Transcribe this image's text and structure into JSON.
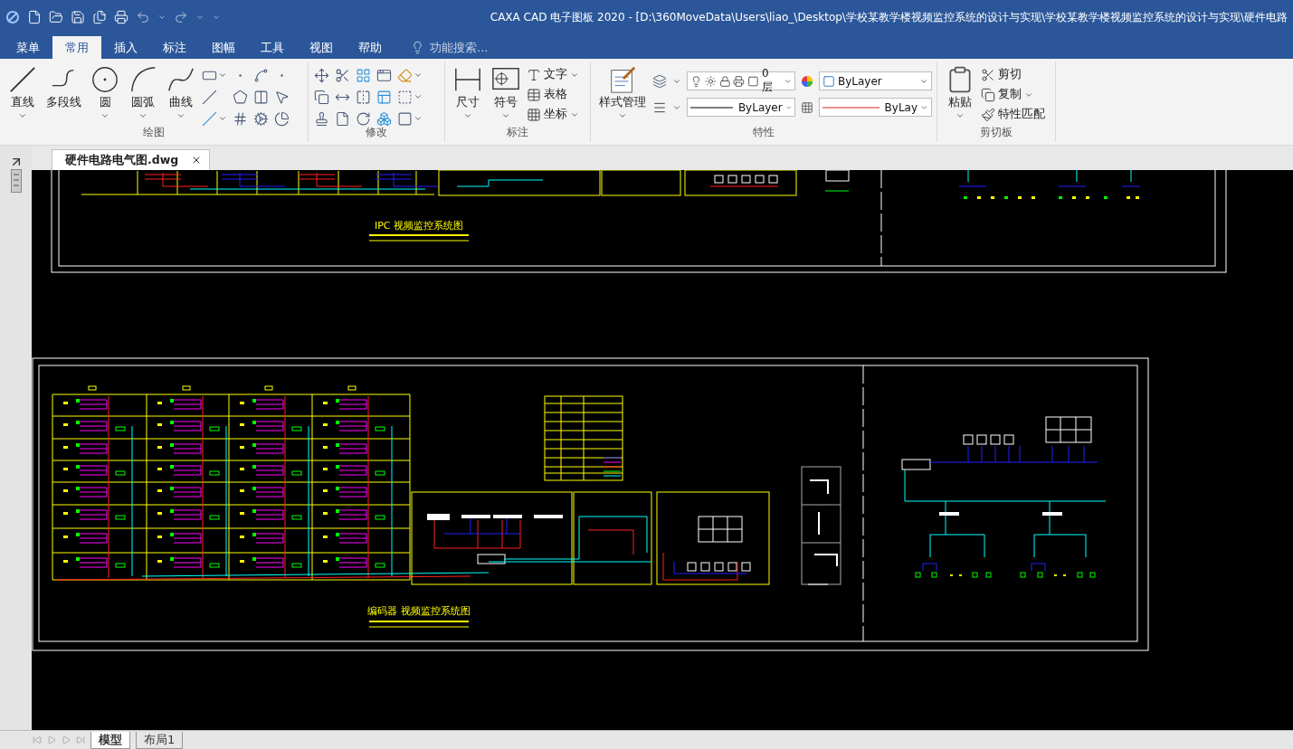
{
  "window": {
    "title": "CAXA CAD 电子图板 2020 - [D:\\360MoveData\\Users\\liao_\\Desktop\\学校某教学楼视频监控系统的设计与实现\\学校某教学楼视频监控系统的设计与实现\\硬件电路"
  },
  "ribbon_tabs": [
    {
      "label": "菜单",
      "selected": false
    },
    {
      "label": "常用",
      "selected": true
    },
    {
      "label": "插入",
      "selected": false
    },
    {
      "label": "标注",
      "selected": false
    },
    {
      "label": "图幅",
      "selected": false
    },
    {
      "label": "工具",
      "selected": false
    },
    {
      "label": "视图",
      "selected": false
    },
    {
      "label": "帮助",
      "selected": false
    }
  ],
  "search": {
    "placeholder": "功能搜索..."
  },
  "ribbon_groups": [
    {
      "kind": "draw",
      "label": "绘图",
      "large_buttons": [
        {
          "label": "直线",
          "dropdown": true
        },
        {
          "label": "多段线",
          "dropdown": false
        },
        {
          "label": "圆",
          "dropdown": true
        },
        {
          "label": "圆弧",
          "dropdown": true
        },
        {
          "label": "曲线",
          "dropdown": true
        }
      ]
    },
    {
      "kind": "modify",
      "label": "修改"
    },
    {
      "kind": "annotate",
      "label": "标注",
      "large_buttons": [
        {
          "label": "尺寸",
          "dropdown": true
        },
        {
          "label": "符号",
          "dropdown": true
        }
      ],
      "small_buttons": [
        {
          "label": "文字",
          "dropdown": true
        },
        {
          "label": "表格",
          "dropdown": false
        },
        {
          "label": "坐标",
          "dropdown": true
        }
      ]
    },
    {
      "kind": "properties",
      "label": "特性",
      "large_buttons": [
        {
          "label": "样式管理",
          "dropdown": true
        }
      ],
      "selects": [
        {
          "kind": "layer",
          "value": "0层"
        },
        {
          "kind": "color",
          "value": "ByLayer"
        },
        {
          "kind": "linetype",
          "value": "ByLayer"
        },
        {
          "kind": "lineweight",
          "value": "ByLay"
        }
      ]
    },
    {
      "kind": "clipboard",
      "label": "剪切板",
      "large_buttons": [
        {
          "label": "粘贴",
          "dropdown": true
        }
      ],
      "small_buttons": [
        {
          "label": "剪切",
          "dropdown": false
        },
        {
          "label": "复制",
          "dropdown": true
        },
        {
          "label": "特性匹配",
          "dropdown": false
        }
      ]
    }
  ],
  "documents": [
    {
      "label": "硬件电路电气图.dwg",
      "selected": true
    }
  ],
  "drawing_titles": [
    "IPC 视频监控系统图",
    "编码器 视频监控系统图"
  ],
  "layout_tabs": [
    {
      "label": "模型",
      "selected": true
    },
    {
      "label": "布局1",
      "selected": false
    }
  ]
}
